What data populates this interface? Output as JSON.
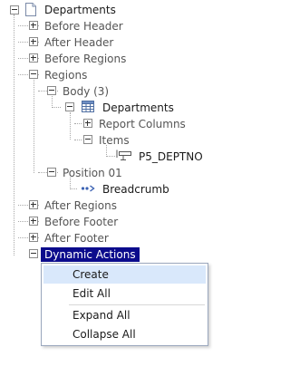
{
  "tree": {
    "root": "Departments",
    "before_header": "Before Header",
    "after_header": "After Header",
    "before_regions": "Before Regions",
    "regions": "Regions",
    "body": "Body (3)",
    "departments_region": "Departments",
    "report_columns": "Report Columns",
    "items": "Items",
    "item_p5": "P5_DEPTNO",
    "position_01": "Position 01",
    "breadcrumb": "Breadcrumb",
    "after_regions": "After Regions",
    "before_footer": "Before Footer",
    "after_footer": "After Footer",
    "dynamic_actions": "Dynamic Actions"
  },
  "context_menu": {
    "create": "Create",
    "edit_all": "Edit All",
    "expand_all": "Expand All",
    "collapse_all": "Collapse All"
  },
  "colors": {
    "selection": "#0b0b8c",
    "menu_hover": "#d9e8fb"
  }
}
